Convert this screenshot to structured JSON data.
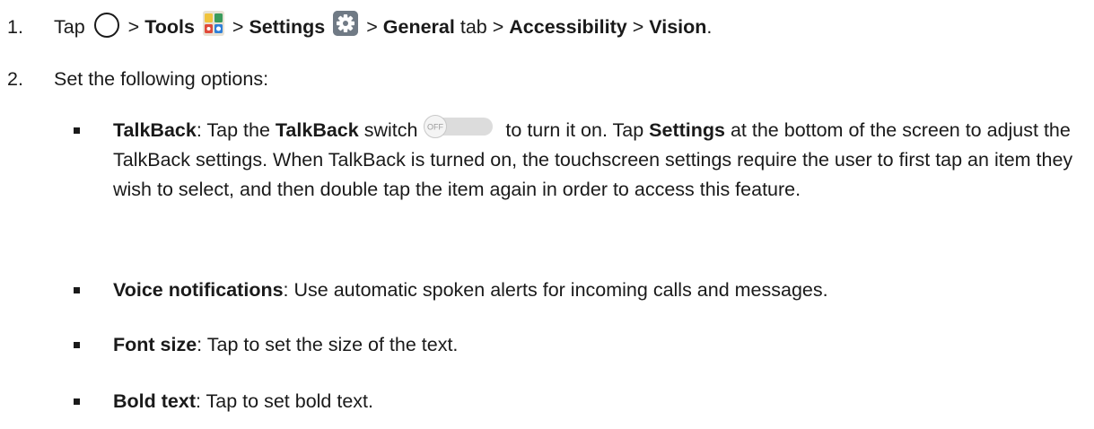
{
  "step1": {
    "number": "1.",
    "tap": "Tap",
    "sep": ">",
    "tools": "Tools",
    "settings": "Settings",
    "general": "General",
    "tab": "tab",
    "accessibility": "Accessibility",
    "vision": "Vision",
    "end": "."
  },
  "step2": {
    "number": "2.",
    "text": "Set the following options:"
  },
  "switch_state": "OFF",
  "bullets": {
    "talkback": {
      "label": "TalkBack",
      "t1": ": Tap the ",
      "bold": "TalkBack",
      "t2": " switch",
      "t3": " to turn it on. Tap ",
      "settings": "Settings",
      "t4": " at the bottom of the screen to adjust the TalkBack settings. When TalkBack is turned on, the touchscreen settings require the user to first tap an item they wish to select, and then double tap the item again in order to access this feature."
    },
    "voice": {
      "label": "Voice notifications",
      "text": ": Use automatic spoken alerts for incoming calls and messages."
    },
    "font": {
      "label": "Font size",
      "text": ": Tap to set the size of the text."
    },
    "bold": {
      "label": "Bold text",
      "text": ": Tap to set bold text."
    }
  }
}
